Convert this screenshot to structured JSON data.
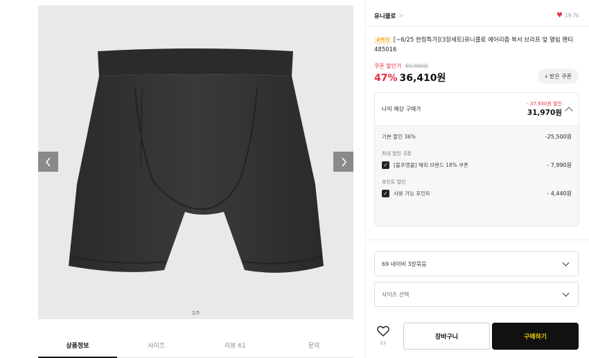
{
  "gallery": {
    "counter": "2/5",
    "prev_icon": "chevron-left-icon",
    "next_icon": "chevron-right-icon"
  },
  "tabs": [
    {
      "label": "상품정보",
      "active": true
    },
    {
      "label": "사이즈",
      "active": false
    },
    {
      "label": "리뷰 61",
      "active": false
    },
    {
      "label": "문의",
      "active": false
    }
  ],
  "brand": {
    "name": "유니클로",
    "chevron": ">",
    "likes": "19.7k"
  },
  "product": {
    "tag": "#특의",
    "title": "[~6/25 한정특가](3장세트)유니클로 에어리즘 복서 브리프 앞 열림 팬티 485016"
  },
  "pricing": {
    "coupon_label": "쿠폰 할인가",
    "original_price": "69,900원",
    "discount_pct": "47%",
    "price": "36,410원",
    "coupon_button": "받은 쿠폰"
  },
  "estimate": {
    "label": "나의 예상 구매가",
    "saving": "- 37,930원 할인",
    "price": "31,970원",
    "base_discount_label": "기본 할인 36%",
    "base_discount_amt": "-25,500원",
    "coupon_section": "최대 할인 쿠폰",
    "coupon_item": "[블프앵콜] 해외 브랜드 18% 쿠폰",
    "coupon_amt": "- 7,990원",
    "point_section": "포인트 할인",
    "point_item": "사용 가능 포인트",
    "point_amt": "- 4,440원"
  },
  "options": {
    "color_value": "69 네이비 3장묶음",
    "size_placeholder": "사이즈 선택"
  },
  "actions": {
    "wish_count": "57",
    "cart": "장바구니",
    "buy": "구매하기"
  },
  "colors": {
    "accent_red": "#e53146",
    "buy_bg": "#111111",
    "buy_text": "#f0c800"
  }
}
